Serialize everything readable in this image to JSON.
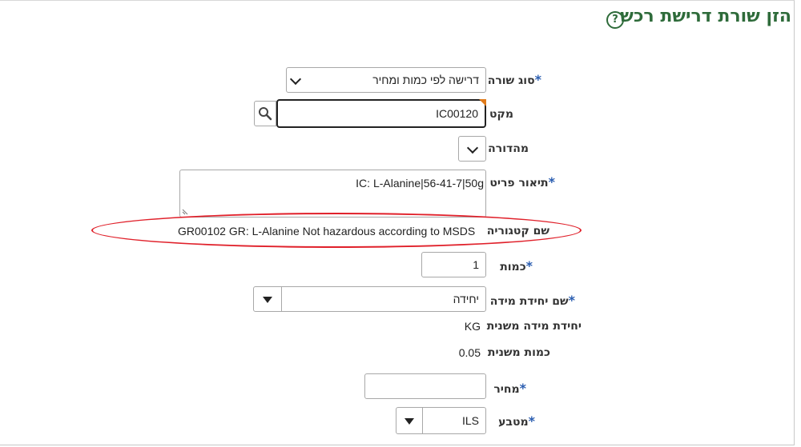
{
  "header": {
    "title": "הזן שורת דרישת רכש",
    "help_icon": "question-circle-icon"
  },
  "form": {
    "line_type": {
      "label": "סוג שורה",
      "value": "דרישה לפי כמות ומחיר"
    },
    "item": {
      "label": "מקט",
      "value": "IC00120"
    },
    "revision": {
      "label": "מהדורה",
      "value": ""
    },
    "item_description": {
      "label": "תיאור פריט",
      "value": "IC: L-Alanine|56-41-7|50g"
    },
    "category_name": {
      "label": "שם קטגוריה",
      "value": "GR00102 GR: L-Alanine Not hazardous according to MSDS"
    },
    "quantity": {
      "label": "כמות",
      "value": "1"
    },
    "uom_name": {
      "label": "שם יחידת מידה",
      "value": "יחידה"
    },
    "secondary_uom": {
      "label": "יחידת מידה משנית",
      "value": "KG"
    },
    "secondary_quantity": {
      "label": "כמות משנית",
      "value": "0.05"
    },
    "price": {
      "label": "מחיר",
      "value": ""
    },
    "currency": {
      "label": "מטבע",
      "value": "ILS"
    }
  },
  "required_marker": "*",
  "colors": {
    "title": "#2e6b3a",
    "required": "#2a5db0",
    "highlight": "#e0202a"
  }
}
